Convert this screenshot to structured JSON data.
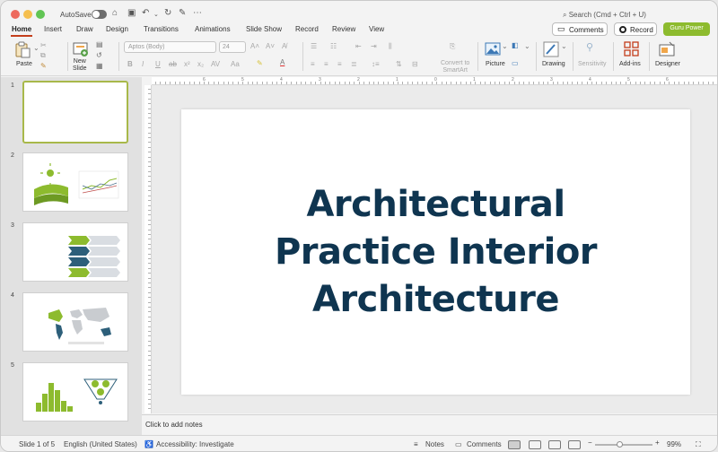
{
  "titlebar": {
    "autosave_label": "AutoSave",
    "search_placeholder": "Search (Cmd + Ctrl + U)"
  },
  "tabs": [
    "Home",
    "Insert",
    "Draw",
    "Design",
    "Transitions",
    "Animations",
    "Slide Show",
    "Record",
    "Review",
    "View"
  ],
  "active_tab": "Home",
  "top_buttons": {
    "comments": "Comments",
    "record": "Record",
    "guru": "Guru Power"
  },
  "ribbon": {
    "paste": "Paste",
    "new_slide_line1": "New",
    "new_slide_line2": "Slide",
    "font_name": "Aptos (Body)",
    "font_size": "24",
    "convert_line1": "Convert to",
    "convert_line2": "SmartArt",
    "picture": "Picture",
    "drawing": "Drawing",
    "sensitivity": "Sensitivity",
    "addins": "Add-ins",
    "designer": "Designer"
  },
  "thumbnails": [
    {
      "num": "1"
    },
    {
      "num": "2"
    },
    {
      "num": "3"
    },
    {
      "num": "4"
    },
    {
      "num": "5"
    }
  ],
  "slide": {
    "title_lines": [
      "Architectural",
      "Practice Interior",
      "Architecture"
    ]
  },
  "notes_placeholder": "Click to add notes",
  "status": {
    "slide_info": "Slide 1 of 5",
    "language": "English (United States)",
    "accessibility": "Accessibility: Investigate",
    "notes": "Notes",
    "comments": "Comments",
    "zoom": "99%"
  },
  "colors": {
    "accent_green": "#8dbb2e",
    "title_navy": "#0f3550",
    "tab_underline": "#c43e1c"
  }
}
